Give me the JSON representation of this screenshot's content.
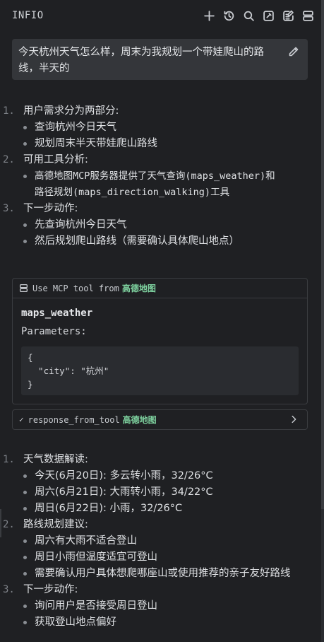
{
  "header": {
    "title": "INFIO",
    "icons": [
      "plus-icon",
      "history-icon",
      "search-icon",
      "new-note-icon",
      "edit-note-icon",
      "server-icon"
    ]
  },
  "user_message": {
    "text_line1": "今天杭州天气怎么样，周末为我规划一个带娃爬山的路",
    "text_line2": "线，半天的"
  },
  "analysis1": {
    "items": [
      {
        "num": "1.",
        "text": "用户需求分为两部分:",
        "bullets": [
          "查询杭州今日天气",
          "规划周末半天带娃爬山路线"
        ]
      },
      {
        "num": "2.",
        "text": "可用工具分析:",
        "bullets": [
          "高德地图MCP服务器提供了天气查询(maps_weather)和",
          "路径规划(maps_direction_walking)工具"
        ]
      },
      {
        "num": "3.",
        "text": "下一步动作:",
        "bullets": [
          "先查询杭州今日天气",
          "然后规划爬山路线（需要确认具体爬山地点）"
        ]
      }
    ]
  },
  "tool_card": {
    "head_prefix": "Use MCP tool from",
    "server_name": "高德地图",
    "tool_name": "maps_weather",
    "params_label": "Parameters:",
    "code": "{\n  \"city\": \"杭州\"\n}"
  },
  "response": {
    "label": "response_from_tool",
    "server_name": "高德地图"
  },
  "analysis2": {
    "items": [
      {
        "num": "1.",
        "text": "天气数据解读:",
        "bullets": [
          "今天(6月20日): 多云转小雨，32/26°C",
          "周六(6月21日): 大雨转小雨，34/22°C",
          "周日(6月22日): 小雨，32/26°C"
        ]
      },
      {
        "num": "2.",
        "text": "路线规划建议:",
        "bullets": [
          "周六有大雨不适合登山",
          "周日小雨但温度适宜可登山",
          "需要确认用户具体想爬哪座山或使用推荐的亲子友好路线"
        ]
      },
      {
        "num": "3.",
        "text": "下一步动作:",
        "bullets": [
          "询问用户是否接受周日登山",
          "获取登山地点偏好"
        ]
      }
    ]
  }
}
